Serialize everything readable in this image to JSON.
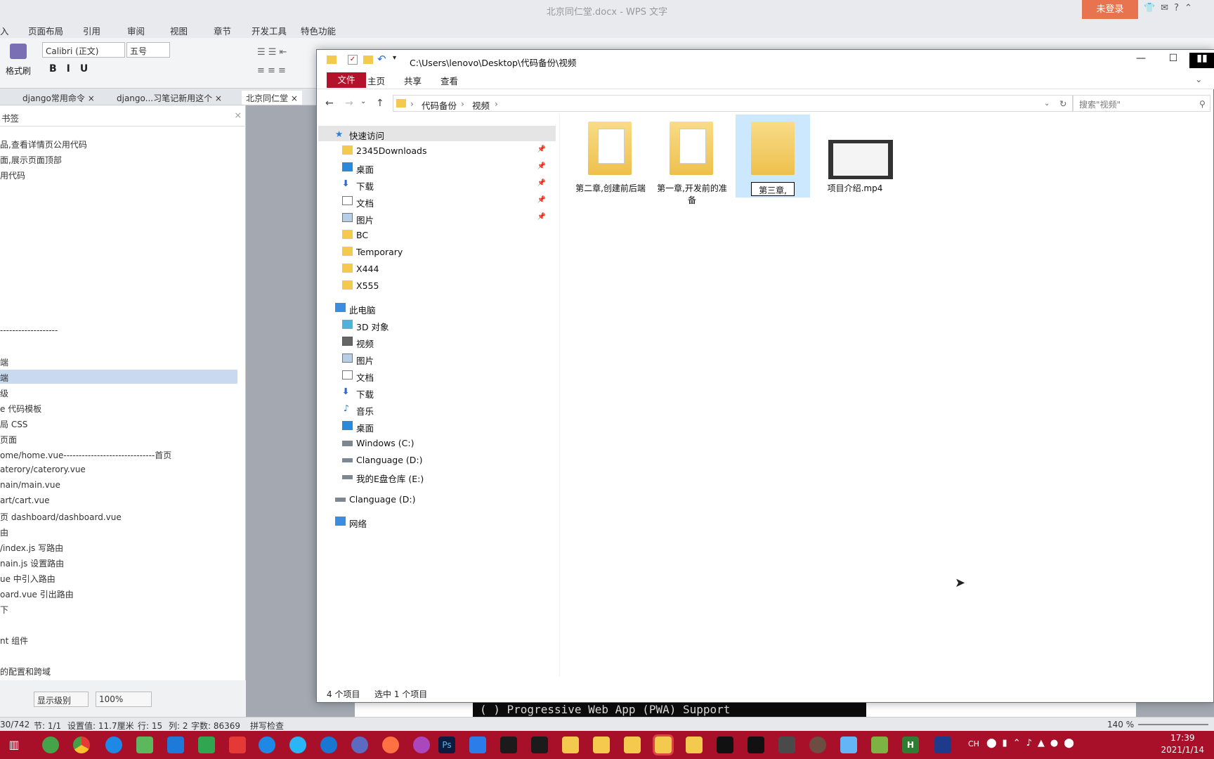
{
  "wps": {
    "title": "北京同仁堂.docx - WPS 文字",
    "login_label": "未登录",
    "menu": [
      "入",
      "页面布局",
      "引用",
      "审阅",
      "视图",
      "章节",
      "开发工具",
      "特色功能"
    ],
    "format_painter": "格式刷",
    "font_name": "Calibri (正文)",
    "font_size": "五号",
    "doc_tabs": [
      "django常用命令",
      "django...习笔记新用这个",
      "北京同仁堂"
    ],
    "nav_title": "书签",
    "nav_lines": [
      "品,查看详情页公用代码",
      "面,展示页面顶部",
      "用代码",
      "-------------------",
      "端",
      "端",
      "级",
      "e 代码模板",
      "局 CSS",
      "页面",
      "ome/home.vue------------------------------首页",
      "aterory/caterory.vue",
      "nain/main.vue",
      "art/cart.vue",
      "页 dashboard/dashboard.vue",
      "由",
      "/index.js 写路由",
      "nain.js 设置路由",
      "ue 中引入路由",
      "oard.vue 引出路由",
      "下",
      "nt 组件",
      "的配置和跨域"
    ],
    "nav_level": "显示级别",
    "nav_zoom": "100%",
    "terminal_text": "( ) Progressive Web App (PWA) Support",
    "status": {
      "page": "30/742",
      "section": "节: 1/1",
      "setting": "设置值: 11.7厘米",
      "row": "行: 15",
      "col": "列: 2",
      "words": "字数: 86369",
      "spell": "拼写检查",
      "zoom": "140 %"
    }
  },
  "explorer": {
    "title_path": "C:\\Users\\lenovo\\Desktop\\代码备份\\视频",
    "ribbon_tabs": [
      "文件",
      "主页",
      "共享",
      "查看"
    ],
    "breadcrumb": [
      "代码备份",
      "视频"
    ],
    "search_placeholder": "搜索\"视频\"",
    "quick_access": "快速访问",
    "quick_items": [
      "2345Downloads",
      "桌面",
      "下载",
      "文档",
      "图片",
      "BC",
      "Temporary",
      "X444",
      "X555"
    ],
    "this_pc": "此电脑",
    "pc_items": [
      "3D 对象",
      "视频",
      "图片",
      "文档",
      "下载",
      "音乐",
      "桌面",
      "Windows (C:)",
      "Clanguage (D:)",
      "我的E盘仓库 (E:)"
    ],
    "drive_d": "Clanguage (D:)",
    "network": "网络",
    "files": [
      {
        "name": "第二章,创建前后端",
        "type": "folder"
      },
      {
        "name": "第一章,开发前的准备",
        "type": "folder"
      },
      {
        "name": "第三章,",
        "type": "folder-renaming"
      },
      {
        "name": "项目介绍.mp4",
        "type": "video"
      }
    ],
    "status_count": "4 个项目",
    "status_selected": "选中 1 个项目"
  },
  "taskbar": {
    "time": "17:39",
    "date": "2021/1/14",
    "ime": "CH"
  },
  "colors": {
    "taskbar": "#a8102a",
    "file_tab": "#b3122a",
    "selection": "#cce8ff",
    "login": "#e8734f"
  }
}
